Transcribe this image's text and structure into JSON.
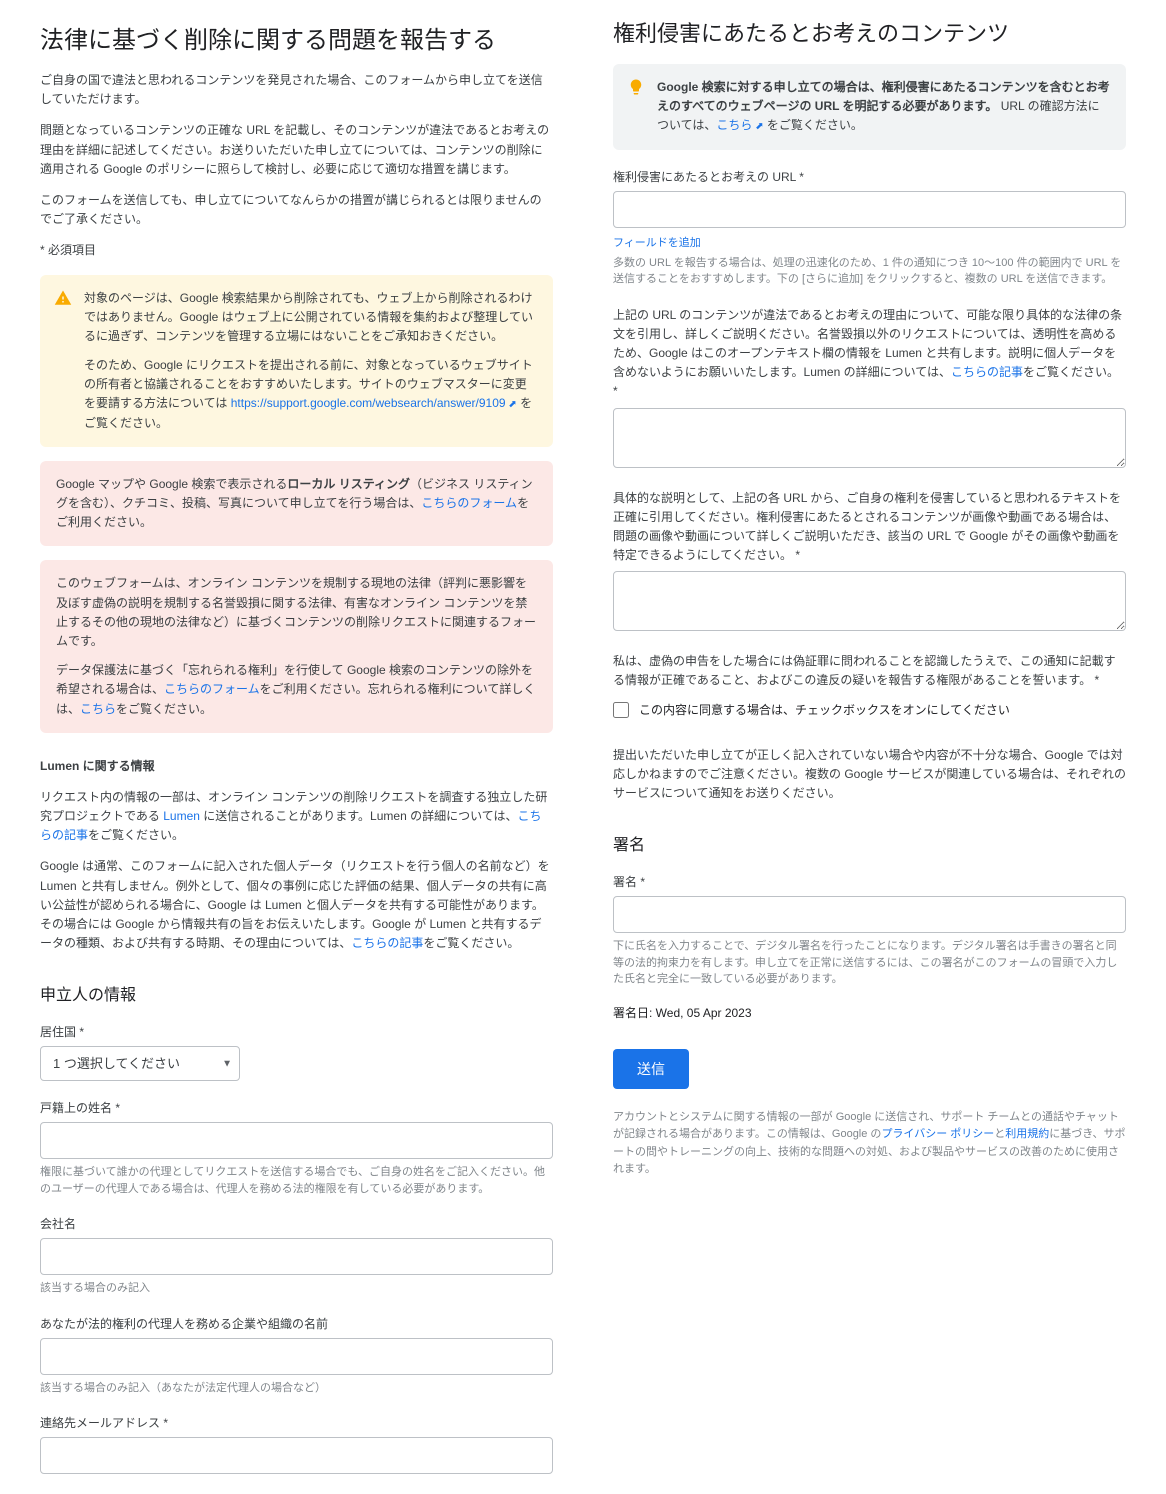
{
  "left": {
    "title": "法律に基づく削除に関する問題を報告する",
    "intro1": "ご自身の国で違法と思われるコンテンツを発見された場合、このフォームから申し立てを送信していただけます。",
    "intro2": "問題となっているコンテンツの正確な URL を記載し、そのコンテンツが違法であるとお考えの理由を詳細に記述してください。お送りいただいた申し立てについては、コンテンツの削除に適用される Google のポリシーに照らして検討し、必要に応じて適切な措置を講じます。",
    "intro3": "このフォームを送信しても、申し立てについてなんらかの措置が講じられるとは限りませんのでご了承ください。",
    "required_note": "* 必須項目",
    "warn1": "対象のページは、Google 検索結果から削除されても、ウェブ上から削除されるわけではありません。Google はウェブ上に公開されている情報を集約および整理しているに過ぎず、コンテンツを管理する立場にはないことをご承知おきください。",
    "warn2_pre": "そのため、Google にリクエストを提出される前に、対象となっているウェブサイトの所有者と協議されることをおすすめいたします。サイトのウェブマスターに変更を要請する方法については ",
    "warn2_link": "https://support.google.com/websearch/answer/9109",
    "warn2_post": " をご覧ください。",
    "pink1_pre": "Google マップや Google 検索で表示される",
    "pink1_bold": "ローカル リスティング",
    "pink1_mid": "（ビジネス リスティングを含む）、クチコミ、投稿、写真について申し立てを行う場合は、",
    "pink1_link": "こちらのフォーム",
    "pink1_post": "をご利用ください。",
    "pink2_p1": "このウェブフォームは、オンライン コンテンツを規制する現地の法律（評判に悪影響を及ぼす虚偽の説明を規制する名誉毀損に関する法律、有害なオンライン コンテンツを禁止するその他の現地の法律など）に基づくコンテンツの削除リクエストに関連するフォームです。",
    "pink2_p2_pre": "データ保護法に基づく「忘れられる権利」を行使して Google 検索のコンテンツの除外を希望される場合は、",
    "pink2_p2_link1": "こちらのフォーム",
    "pink2_p2_mid": "をご利用ください。忘れられる権利について詳しくは、",
    "pink2_p2_link2": "こちら",
    "pink2_p2_post": "をご覧ください。",
    "lumen_heading": "Lumen に関する情報",
    "lumen_p1_pre": "リクエスト内の情報の一部は、オンライン コンテンツの削除リクエストを調査する独立した研究プロジェクトである ",
    "lumen_p1_link1": "Lumen",
    "lumen_p1_mid": " に送信されることがあります。Lumen の詳細については、",
    "lumen_p1_link2": "こちらの記事",
    "lumen_p1_post": "をご覧ください。",
    "lumen_p2_pre": "Google は通常、このフォームに記入された個人データ（リクエストを行う個人の名前など）を Lumen と共有しません。例外として、個々の事例に応じた評価の結果、個人データの共有に高い公益性が認められる場合に、Google は Lumen と個人データを共有する可能性があります。その場合には Google から情報共有の旨をお伝えいたします。Google が Lumen と共有するデータの種類、および共有する時期、その理由については、",
    "lumen_p2_link": "こちらの記事",
    "lumen_p2_post": "をご覧ください。",
    "applicant_heading": "申立人の情報",
    "country_label": "居住国 *",
    "country_placeholder": "1 つ選択してください",
    "legalname_label": "戸籍上の姓名 *",
    "legalname_hint": "権限に基づいて誰かの代理としてリクエストを送信する場合でも、ご自身の姓名をご記入ください。他のユーザーの代理人である場合は、代理人を務める法的権限を有している必要があります。",
    "company_label": "会社名",
    "company_hint": "該当する場合のみ記入",
    "rep_label": "あなたが法的権利の代理人を務める企業や組織の名前",
    "rep_hint": "該当する場合のみ記入（あなたが法定代理人の場合など）",
    "email_label": "連絡先メールアドレス *"
  },
  "right": {
    "title": "権利侵害にあたるとお考えのコンテンツ",
    "grey_pre": "Google 検索に対する申し立ての場合は、権利侵害にあたるコンテンツを含むとお考えのすべてのウェブページの URL を明記する必要があります。",
    "grey_mid": " URL の確認方法については、",
    "grey_link": "こちら",
    "grey_post": " をご覧ください。",
    "url_label": "権利侵害にあたるとお考えの URL *",
    "add_field": "フィールドを追加",
    "url_hint": "多数の URL を報告する場合は、処理の迅速化のため、1 件の通知につき 10～100 件の範囲内で URL を送信することをおすすめします。下の [さらに追加] をクリックすると、複数の URL を送信できます。",
    "reason_label_pre": "上記の URL のコンテンツが違法であるとお考えの理由について、可能な限り具体的な法律の条文を引用し、詳しくご説明ください。名誉毀損以外のリクエストについては、透明性を高めるため、Google はこのオープンテキスト欄の情報を Lumen と共有します。説明に個人データを含めないようにお願いいたします。Lumen の詳細については、",
    "reason_label_link": "こちらの記事",
    "reason_label_post": "をご覧ください。 *",
    "detail_label": "具体的な説明として、上記の各 URL から、ご自身の権利を侵害していると思われるテキストを正確に引用してください。権利侵害にあたるとされるコンテンツが画像や動画である場合は、問題の画像や動画について詳しくご説明いただき、該当の URL で Google がその画像や動画を特定できるようにしてください。 *",
    "oath_text": "私は、虚偽の申告をした場合には偽証罪に問われることを認識したうえで、この通知に記載する情報が正確であること、およびこの違反の疑いを報告する権限があることを誓います。 *",
    "checkbox_label": "この内容に同意する場合は、チェックボックスをオンにしてください",
    "submit_note": "提出いただいた申し立てが正しく記入されていない場合や内容が不十分な場合、Google では対応しかねますのでご注意ください。複数の Google サービスが関連している場合は、それぞれのサービスについて通知をお送りください。",
    "sign_heading": "署名",
    "sign_label": "署名 *",
    "sign_hint": "下に氏名を入力することで、デジタル署名を行ったことになります。デジタル署名は手書きの署名と同等の法的拘束力を有します。申し立てを正常に送信するには、この署名がこのフォームの冒頭で入力した氏名と完全に一致している必要があります。",
    "sign_date_label": "署名日: ",
    "sign_date_value": "Wed, 05 Apr 2023",
    "submit_button": "送信",
    "footer_pre": "アカウントとシステムに関する情報の一部が Google に送信され、サポート チームとの通話やチャットが記録される場合があります。この情報は、Google の",
    "footer_link1": "プライバシー ポリシー",
    "footer_and": "と",
    "footer_link2": "利用規約",
    "footer_post": "に基づき、サポートの問やトレーニングの向上、技術的な問題への対処、および製品やサービスの改善のために使用されます。"
  }
}
